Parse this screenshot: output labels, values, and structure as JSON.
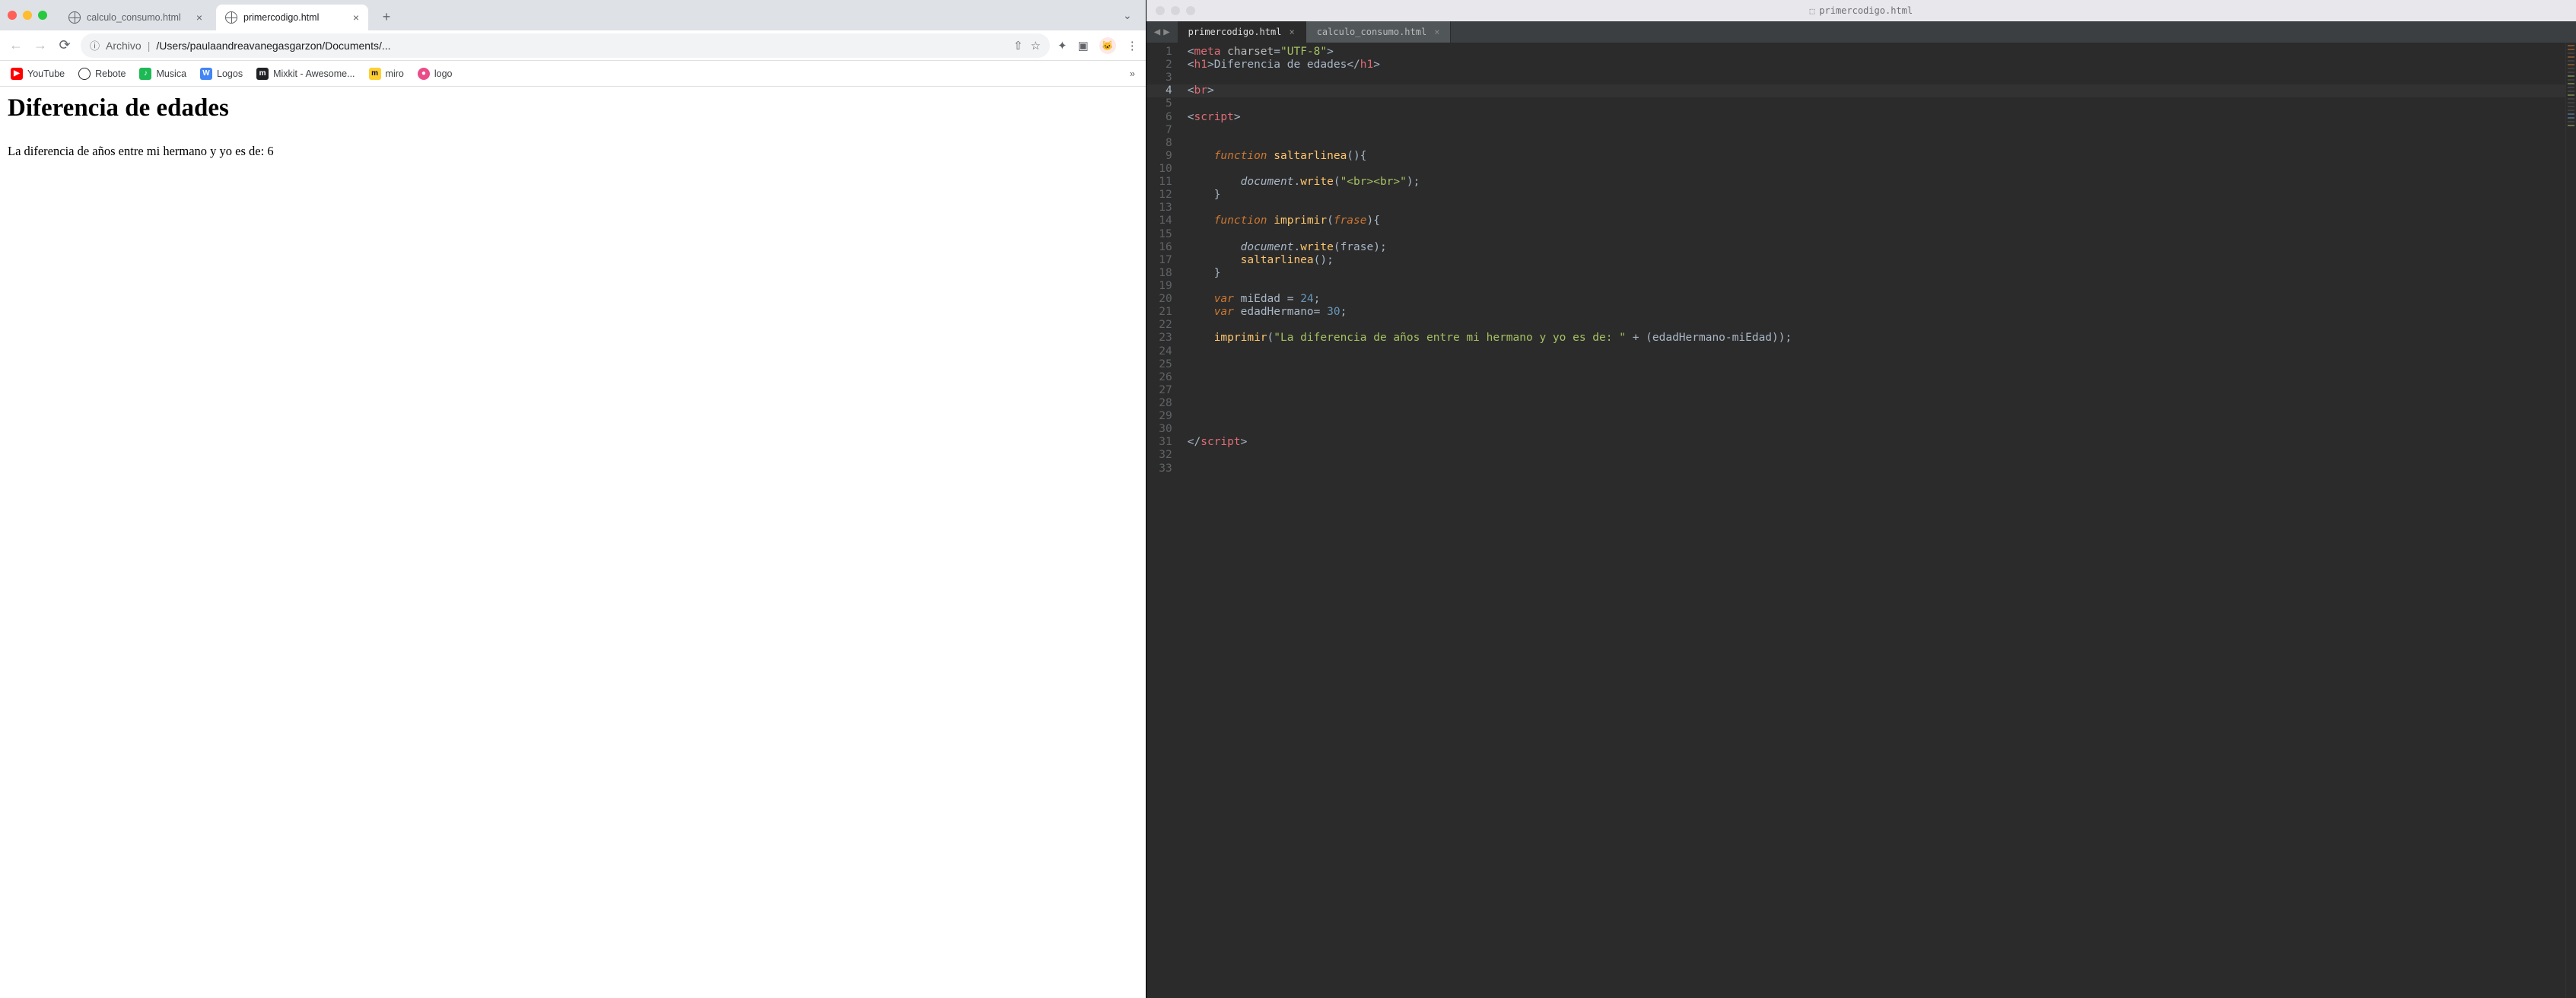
{
  "browser": {
    "tabs": [
      {
        "title": "calculo_consumo.html",
        "active": false
      },
      {
        "title": "primercodigo.html",
        "active": true
      }
    ],
    "toolbar": {
      "protocol_label": "Archivo",
      "path": "/Users/paulaandreavanegasgarzon/Documents/..."
    },
    "bookmarks": [
      {
        "label": "YouTube",
        "icon_bg": "#ff0000",
        "icon_txt": "▶"
      },
      {
        "label": "Rebote",
        "icon_bg": "#24292e",
        "icon_txt": "",
        "icon_shape": "ring"
      },
      {
        "label": "Musica",
        "icon_bg": "#1db954",
        "icon_txt": "S"
      },
      {
        "label": "Logos",
        "icon_bg": "#4285f4",
        "icon_txt": "W"
      },
      {
        "label": "Mixkit - Awesome...",
        "icon_bg": "#202124",
        "icon_txt": "m"
      },
      {
        "label": "miro",
        "icon_bg": "#ffd02f",
        "icon_txt": "m"
      },
      {
        "label": "logo",
        "icon_bg": "#ea4c89",
        "icon_txt": "●"
      }
    ],
    "page": {
      "heading": "Diferencia de edades",
      "body_text": "La diferencia de años entre mi hermano y yo es de: 6"
    }
  },
  "editor": {
    "window_title": "primercodigo.html",
    "tabs": [
      {
        "title": "primercodigo.html",
        "active": true
      },
      {
        "title": "calculo_consumo.html",
        "active": false
      }
    ],
    "code": {
      "line_count": 33,
      "highlighted_line": 4,
      "lines": [
        {
          "n": 1,
          "tokens": [
            [
              "t-punc",
              "<"
            ],
            [
              "t-tagname",
              "meta"
            ],
            [
              "t-punc",
              " "
            ],
            [
              "t-attr",
              "charset"
            ],
            [
              "t-punc",
              "="
            ],
            [
              "t-str",
              "\"UTF-8\""
            ],
            [
              "t-punc",
              ">"
            ]
          ]
        },
        {
          "n": 2,
          "tokens": [
            [
              "t-punc",
              "<"
            ],
            [
              "t-tagname",
              "h1"
            ],
            [
              "t-punc",
              ">"
            ],
            [
              "t-punc",
              "Diferencia de edades"
            ],
            [
              "t-punc",
              "</"
            ],
            [
              "t-tagname",
              "h1"
            ],
            [
              "t-punc",
              ">"
            ]
          ]
        },
        {
          "n": 3,
          "tokens": []
        },
        {
          "n": 4,
          "tokens": [
            [
              "t-punc",
              "<"
            ],
            [
              "t-tagname",
              "br"
            ],
            [
              "t-punc",
              ">"
            ]
          ]
        },
        {
          "n": 5,
          "tokens": []
        },
        {
          "n": 6,
          "tokens": [
            [
              "t-punc",
              "<"
            ],
            [
              "t-tagname",
              "script"
            ],
            [
              "t-punc",
              ">"
            ]
          ]
        },
        {
          "n": 7,
          "tokens": []
        },
        {
          "n": 8,
          "tokens": []
        },
        {
          "n": 9,
          "tokens": [
            [
              "",
              "    "
            ],
            [
              "t-kw",
              "function"
            ],
            [
              "",
              " "
            ],
            [
              "t-fn",
              "saltarlinea"
            ],
            [
              "t-punc",
              "(){"
            ]
          ]
        },
        {
          "n": 10,
          "tokens": []
        },
        {
          "n": 11,
          "tokens": [
            [
              "",
              "        "
            ],
            [
              "t-obj",
              "document"
            ],
            [
              "t-punc",
              "."
            ],
            [
              "t-fn",
              "write"
            ],
            [
              "t-punc",
              "("
            ],
            [
              "t-str",
              "\"<br><br>\""
            ],
            [
              "t-punc",
              ");"
            ]
          ]
        },
        {
          "n": 12,
          "tokens": [
            [
              "",
              "    "
            ],
            [
              "t-punc",
              "}"
            ]
          ]
        },
        {
          "n": 13,
          "tokens": []
        },
        {
          "n": 14,
          "tokens": [
            [
              "",
              "    "
            ],
            [
              "t-kw",
              "function"
            ],
            [
              "",
              " "
            ],
            [
              "t-fn",
              "imprimir"
            ],
            [
              "t-punc",
              "("
            ],
            [
              "t-param",
              "frase"
            ],
            [
              "t-punc",
              "){"
            ]
          ]
        },
        {
          "n": 15,
          "tokens": []
        },
        {
          "n": 16,
          "tokens": [
            [
              "",
              "        "
            ],
            [
              "t-obj",
              "document"
            ],
            [
              "t-punc",
              "."
            ],
            [
              "t-fn",
              "write"
            ],
            [
              "t-punc",
              "(frase);"
            ]
          ]
        },
        {
          "n": 17,
          "tokens": [
            [
              "",
              "        "
            ],
            [
              "t-fn",
              "saltarlinea"
            ],
            [
              "t-punc",
              "();"
            ]
          ]
        },
        {
          "n": 18,
          "tokens": [
            [
              "",
              "    "
            ],
            [
              "t-punc",
              "}"
            ]
          ]
        },
        {
          "n": 19,
          "tokens": []
        },
        {
          "n": 20,
          "tokens": [
            [
              "",
              "    "
            ],
            [
              "t-kw",
              "var"
            ],
            [
              "",
              " "
            ],
            [
              "t-punc",
              "miEdad "
            ],
            [
              "t-op",
              "="
            ],
            [
              "",
              " "
            ],
            [
              "t-num",
              "24"
            ],
            [
              "t-punc",
              ";"
            ]
          ]
        },
        {
          "n": 21,
          "tokens": [
            [
              "",
              "    "
            ],
            [
              "t-kw",
              "var"
            ],
            [
              "",
              " "
            ],
            [
              "t-punc",
              "edadHermano"
            ],
            [
              "t-op",
              "="
            ],
            [
              "",
              " "
            ],
            [
              "t-num",
              "30"
            ],
            [
              "t-punc",
              ";"
            ]
          ]
        },
        {
          "n": 22,
          "tokens": []
        },
        {
          "n": 23,
          "tokens": [
            [
              "",
              "    "
            ],
            [
              "t-fn",
              "imprimir"
            ],
            [
              "t-punc",
              "("
            ],
            [
              "t-str",
              "\"La diferencia de años entre mi hermano y yo es de: \""
            ],
            [
              "",
              " "
            ],
            [
              "t-op",
              "+"
            ],
            [
              "",
              " "
            ],
            [
              "t-punc",
              "(edadHermano"
            ],
            [
              "t-op",
              "-"
            ],
            [
              "t-punc",
              "miEdad));"
            ]
          ]
        },
        {
          "n": 24,
          "tokens": []
        },
        {
          "n": 25,
          "tokens": []
        },
        {
          "n": 26,
          "tokens": []
        },
        {
          "n": 27,
          "tokens": []
        },
        {
          "n": 28,
          "tokens": []
        },
        {
          "n": 29,
          "tokens": []
        },
        {
          "n": 30,
          "tokens": []
        },
        {
          "n": 31,
          "tokens": [
            [
              "t-punc",
              "</"
            ],
            [
              "t-tagname",
              "script"
            ],
            [
              "t-punc",
              ">"
            ]
          ]
        },
        {
          "n": 32,
          "tokens": []
        },
        {
          "n": 33,
          "tokens": []
        }
      ]
    }
  }
}
